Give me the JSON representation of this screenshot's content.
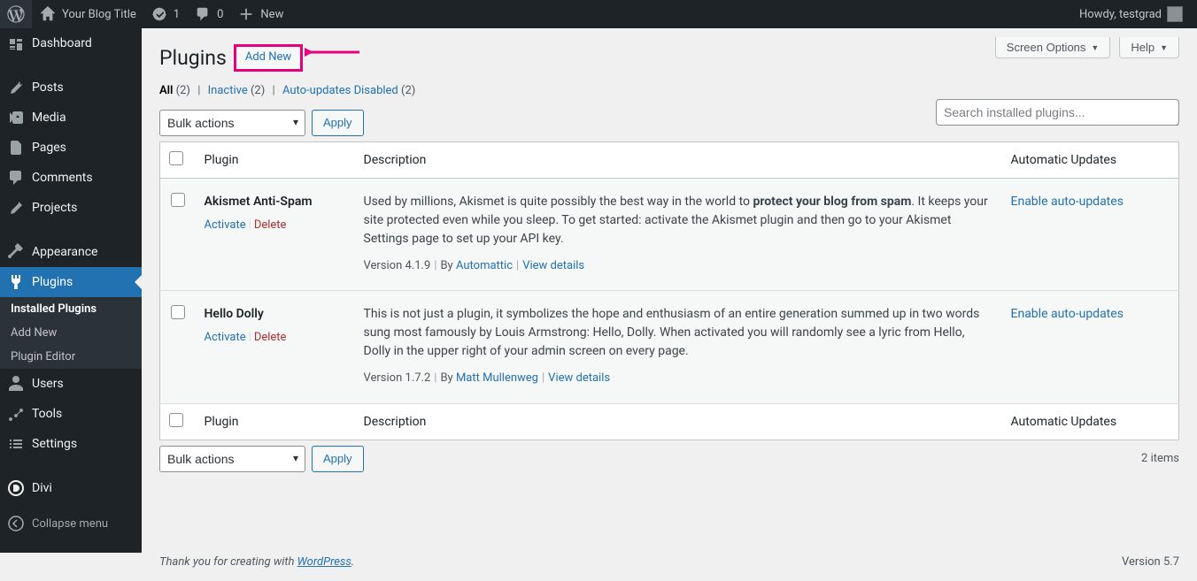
{
  "adminbar": {
    "site_title": "Your Blog Title",
    "updates_count": "1",
    "comments_count": "0",
    "new_label": "New",
    "howdy": "Howdy, testgrad"
  },
  "sidebar": {
    "items": [
      {
        "label": "Dashboard"
      },
      {
        "label": "Posts"
      },
      {
        "label": "Media"
      },
      {
        "label": "Pages"
      },
      {
        "label": "Comments"
      },
      {
        "label": "Projects"
      },
      {
        "label": "Appearance"
      },
      {
        "label": "Plugins"
      },
      {
        "label": "Users"
      },
      {
        "label": "Tools"
      },
      {
        "label": "Settings"
      },
      {
        "label": "Divi"
      }
    ],
    "submenu_plugins": [
      {
        "label": "Installed Plugins"
      },
      {
        "label": "Add New"
      },
      {
        "label": "Plugin Editor"
      }
    ],
    "collapse_label": "Collapse menu"
  },
  "top_actions": {
    "screen_options": "Screen Options",
    "help": "Help"
  },
  "page": {
    "title": "Plugins",
    "add_new": "Add New"
  },
  "filters": {
    "all_label": "All",
    "all_count": "(2)",
    "inactive_label": "Inactive",
    "inactive_count": "(2)",
    "auto_disabled_label": "Auto-updates Disabled",
    "auto_disabled_count": "(2)"
  },
  "search": {
    "placeholder": "Search installed plugins..."
  },
  "bulk": {
    "label": "Bulk actions",
    "apply": "Apply"
  },
  "items_count": "2 items",
  "table_headers": {
    "plugin": "Plugin",
    "description": "Description",
    "auto": "Automatic Updates"
  },
  "plugins": [
    {
      "name": "Akismet Anti-Spam",
      "activate": "Activate",
      "delete": "Delete",
      "desc_pre": "Used by millions, Akismet is quite possibly the best way in the world to ",
      "desc_strong": "protect your blog from spam",
      "desc_post": ". It keeps your site protected even while you sleep. To get started: activate the Akismet plugin and then go to your Akismet Settings page to set up your API key.",
      "version": "Version 4.1.9",
      "by": "By",
      "author": "Automattic",
      "view_details": "View details",
      "auto_link": "Enable auto-updates"
    },
    {
      "name": "Hello Dolly",
      "activate": "Activate",
      "delete": "Delete",
      "desc": "This is not just a plugin, it symbolizes the hope and enthusiasm of an entire generation summed up in two words sung most famously by Louis Armstrong: Hello, Dolly. When activated you will randomly see a lyric from Hello, Dolly in the upper right of your admin screen on every page.",
      "version": "Version 1.7.2",
      "by": "By",
      "author": "Matt Mullenweg",
      "view_details": "View details",
      "auto_link": "Enable auto-updates"
    }
  ],
  "footer": {
    "thank_pre": "Thank you for creating with ",
    "wordpress": "WordPress",
    "thank_post": ".",
    "version": "Version 5.7"
  }
}
